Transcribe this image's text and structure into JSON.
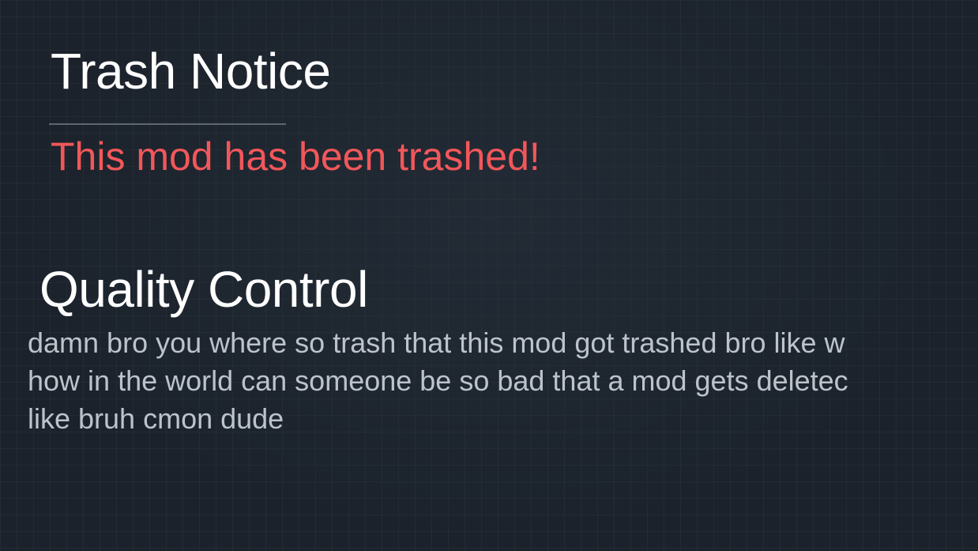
{
  "notice": {
    "title": "Trash Notice",
    "status_message": "This mod has been trashed!"
  },
  "quality_control": {
    "heading": "Quality Control",
    "lines": [
      "damn bro you where so trash that this mod got trashed bro like w",
      "how in the world can someone be so bad that a mod gets deletec",
      "like bruh cmon dude"
    ]
  },
  "colors": {
    "background": "#1b222b",
    "title": "#ffffff",
    "notice_red": "#f2575a",
    "body_text": "#bdc3cb",
    "divider": "#5f6670"
  }
}
